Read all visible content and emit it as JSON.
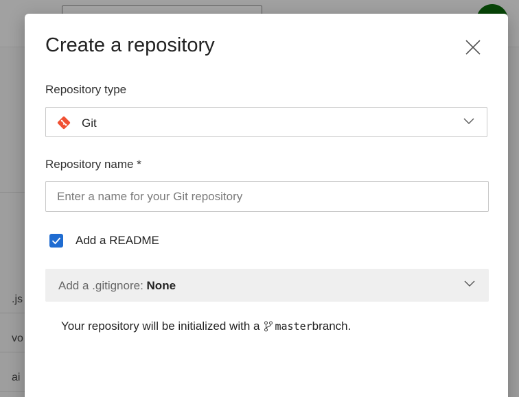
{
  "background": {
    "row_fragments": [
      ".js",
      "vo",
      "ai"
    ]
  },
  "dialog": {
    "title": "Create a repository",
    "close_icon": "close-icon",
    "repo_type": {
      "label": "Repository type",
      "selected": "Git",
      "icon": "git-icon",
      "accent_color": "#f05133"
    },
    "repo_name": {
      "label": "Repository name *",
      "value": "",
      "placeholder": "Enter a name for your Git repository"
    },
    "readme": {
      "label": "Add a README",
      "checked": true,
      "color": "#1f6cd1"
    },
    "gitignore": {
      "prefix": "Add a .gitignore: ",
      "value": "None"
    },
    "init_note": {
      "before": "Your repository will be initialized with a ",
      "branch": "master",
      "after": " branch."
    }
  }
}
